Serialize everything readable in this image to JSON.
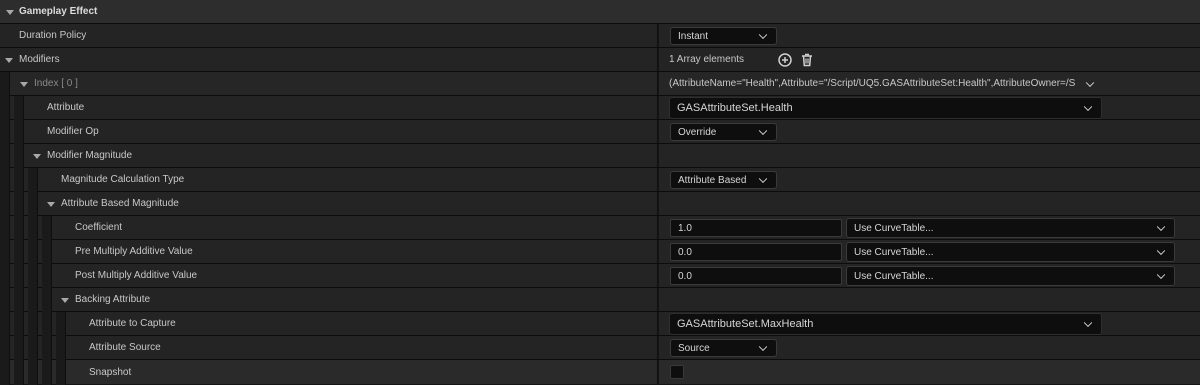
{
  "colors": {
    "background": "#151515",
    "row": "#242424",
    "category_row": "#2d2d2d",
    "field": "#0e0e0e"
  },
  "category": {
    "title": "Gameplay Effect"
  },
  "duration_policy": {
    "label": "Duration Policy",
    "value": "Instant"
  },
  "modifiers": {
    "label": "Modifiers",
    "count_text": "1 Array elements",
    "add_icon": "plus-circle-icon",
    "delete_icon": "trash-icon"
  },
  "index0": {
    "label": "Index [ 0 ]",
    "summary": "(AttributeName=\"Health\",Attribute=\"/Script/UQ5.GASAttributeSet:Health\",AttributeOwner=/S"
  },
  "attribute": {
    "label": "Attribute",
    "value": "GASAttributeSet.Health"
  },
  "modifier_op": {
    "label": "Modifier Op",
    "value": "Override"
  },
  "modifier_magnitude": {
    "label": "Modifier Magnitude"
  },
  "magnitude_calc_type": {
    "label": "Magnitude Calculation Type",
    "value": "Attribute Based"
  },
  "attribute_based_magnitude": {
    "label": "Attribute Based Magnitude"
  },
  "coefficient": {
    "label": "Coefficient",
    "value": "1.0",
    "curve": "Use CurveTable..."
  },
  "pre_multiply": {
    "label": "Pre Multiply Additive Value",
    "value": "0.0",
    "curve": "Use CurveTable..."
  },
  "post_multiply": {
    "label": "Post Multiply Additive Value",
    "value": "0.0",
    "curve": "Use CurveTable..."
  },
  "backing_attribute": {
    "label": "Backing Attribute"
  },
  "attribute_to_capture": {
    "label": "Attribute to Capture",
    "value": "GASAttributeSet.MaxHealth"
  },
  "attribute_source": {
    "label": "Attribute Source",
    "value": "Source"
  },
  "snapshot": {
    "label": "Snapshot",
    "checked": false
  }
}
